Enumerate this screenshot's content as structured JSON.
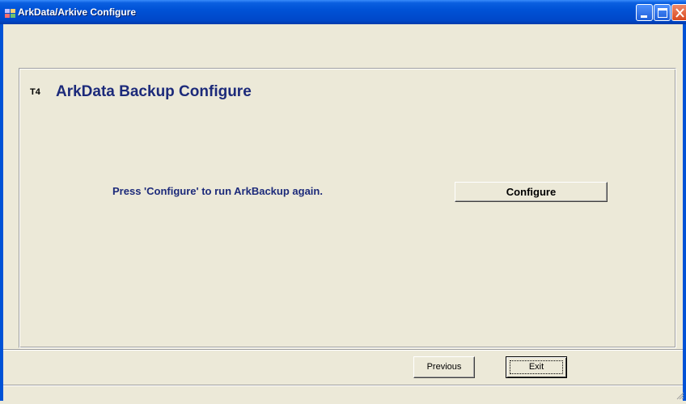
{
  "window": {
    "title": "ArkData/Arkive Configure",
    "icon": "app-icon",
    "controls": [
      "minimize-icon",
      "maximize-icon",
      "close-icon"
    ]
  },
  "panel": {
    "step_tag": "T4",
    "title": "ArkData Backup Configure",
    "instruction": "Press 'Configure' to run ArkBackup again.",
    "configure_label": "Configure"
  },
  "footer": {
    "previous_label": "Previous",
    "exit_label": "Exit"
  },
  "colors": {
    "titlebar": "#0052d6",
    "window_bg": "#ece9d8",
    "heading_text": "#1c2a7a"
  }
}
